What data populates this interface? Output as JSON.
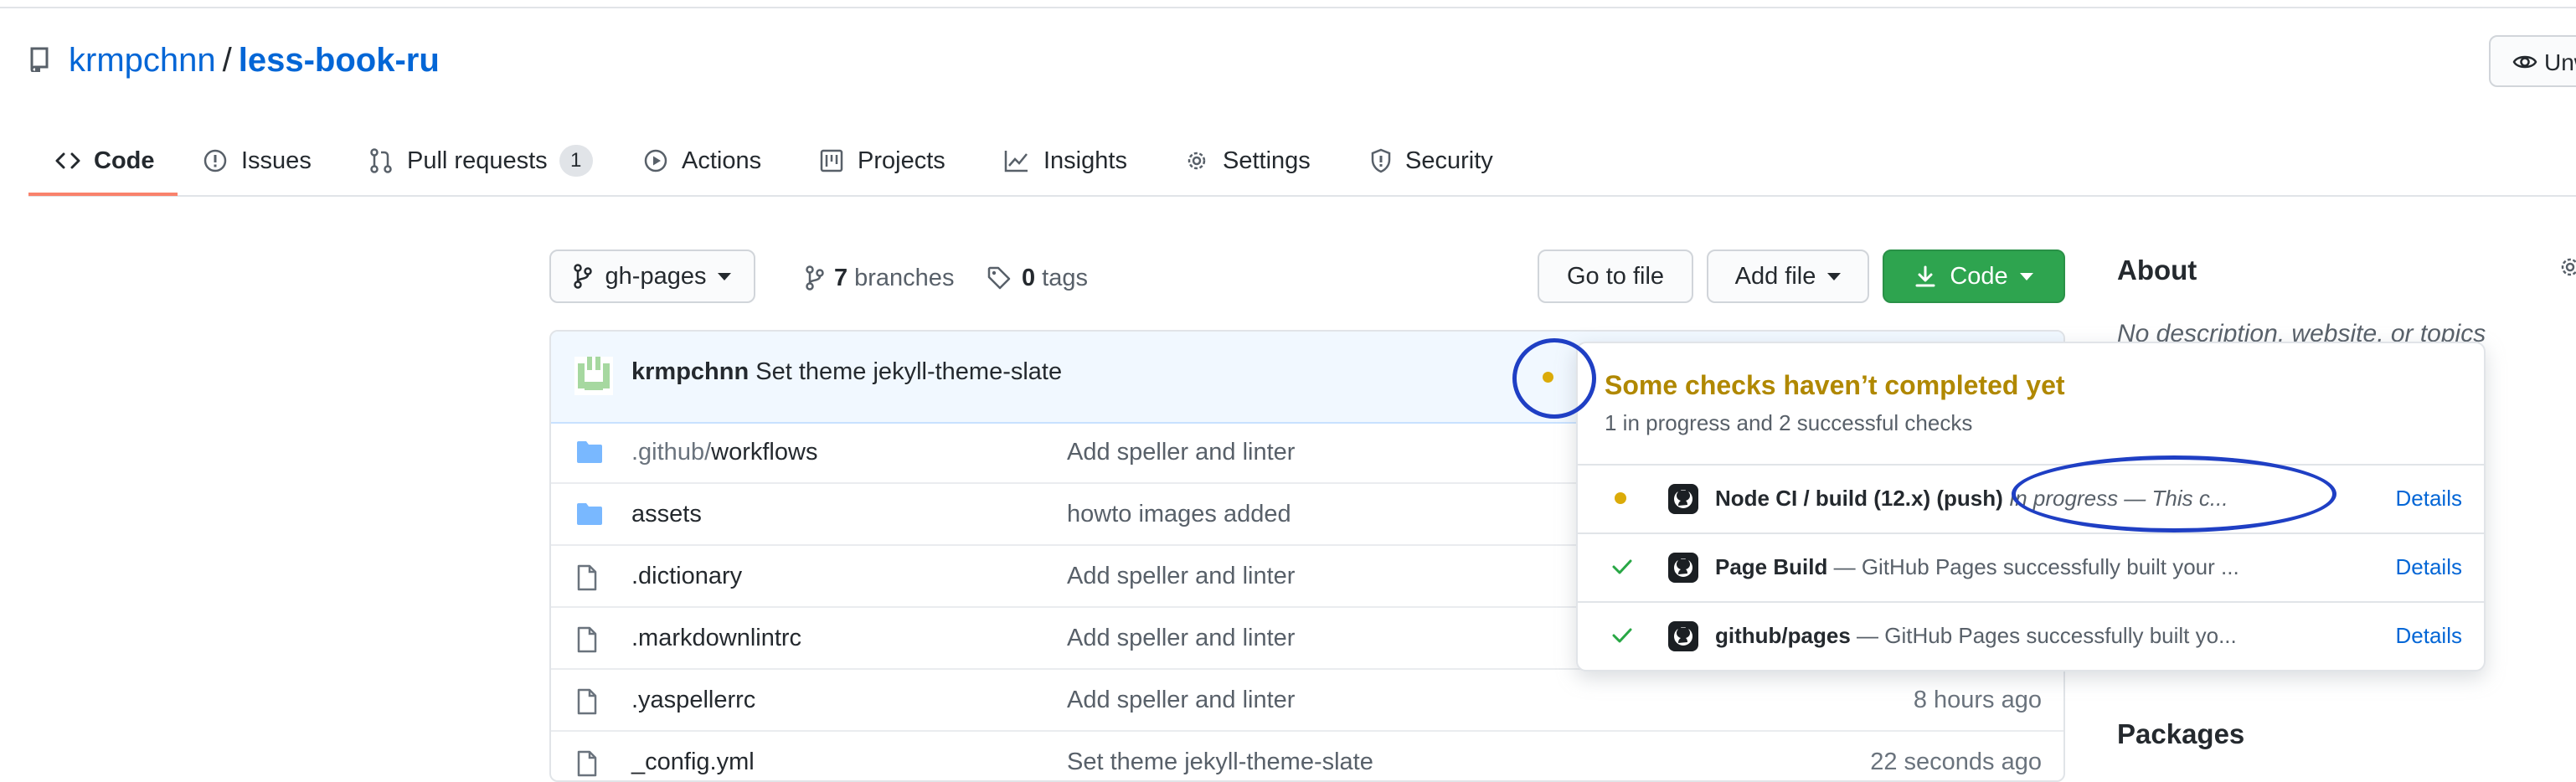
{
  "repo": {
    "owner": "krmpchnn",
    "separator": "/",
    "name": "less-book-ru",
    "watch_label": "Unw"
  },
  "tabs": [
    {
      "label": "Code",
      "icon": "code-icon"
    },
    {
      "label": "Issues",
      "icon": "issue-opened-icon"
    },
    {
      "label": "Pull requests",
      "icon": "git-pull-request-icon",
      "count": "1"
    },
    {
      "label": "Actions",
      "icon": "play-icon"
    },
    {
      "label": "Projects",
      "icon": "project-icon"
    },
    {
      "label": "Insights",
      "icon": "graph-icon"
    },
    {
      "label": "Settings",
      "icon": "gear-icon"
    },
    {
      "label": "Security",
      "icon": "shield-icon"
    }
  ],
  "toolbar": {
    "branch": "gh-pages",
    "branches_count": "7",
    "branches_label": "branches",
    "tags_count": "0",
    "tags_label": "tags",
    "go_to_file": "Go to file",
    "add_file": "Add file",
    "code": "Code"
  },
  "commit": {
    "author": "krmpchnn",
    "message": "Set theme jekyll-theme-slate"
  },
  "files": [
    {
      "type": "folder",
      "name_dim": ".github/",
      "name": "workflows",
      "message": "Add speller and linter",
      "age": ""
    },
    {
      "type": "folder",
      "name_dim": "",
      "name": "assets",
      "message": "howto images added",
      "age": ""
    },
    {
      "type": "file",
      "name_dim": "",
      "name": ".dictionary",
      "message": "Add speller and linter",
      "age": ""
    },
    {
      "type": "file",
      "name_dim": "",
      "name": ".markdownlintrc",
      "message": "Add speller and linter",
      "age": ""
    },
    {
      "type": "file",
      "name_dim": "",
      "name": ".yaspellerrc",
      "message": "Add speller and linter",
      "age": "8 hours ago"
    },
    {
      "type": "file",
      "name_dim": "",
      "name": "_config.yml",
      "message": "Set theme jekyll-theme-slate",
      "age": "22 seconds ago"
    }
  ],
  "about": {
    "heading": "About",
    "description": "No description, website, or topics"
  },
  "packages": {
    "heading": "Packages"
  },
  "checks_popover": {
    "title": "Some checks haven’t completed yet",
    "subtitle": "1 in progress and 2 successful checks",
    "checks": [
      {
        "status": "in-progress",
        "name": "Node CI / build (12.x) (push)",
        "separator": "",
        "description": "In progress — This c...",
        "details": "Details"
      },
      {
        "status": "success",
        "name": "Page Build",
        "separator": " — ",
        "description": "GitHub Pages successfully built your ...",
        "details": "Details"
      },
      {
        "status": "success",
        "name": "github/pages",
        "separator": " — ",
        "description": "GitHub Pages successfully built yo...",
        "details": "Details"
      }
    ]
  },
  "colors": {
    "link": "#0366d6",
    "pending": "#dbab09",
    "success": "#28a745",
    "primary_button": "#2ea44f",
    "tab_underline": "#f9826c",
    "annotation": "#1f3fc4"
  }
}
